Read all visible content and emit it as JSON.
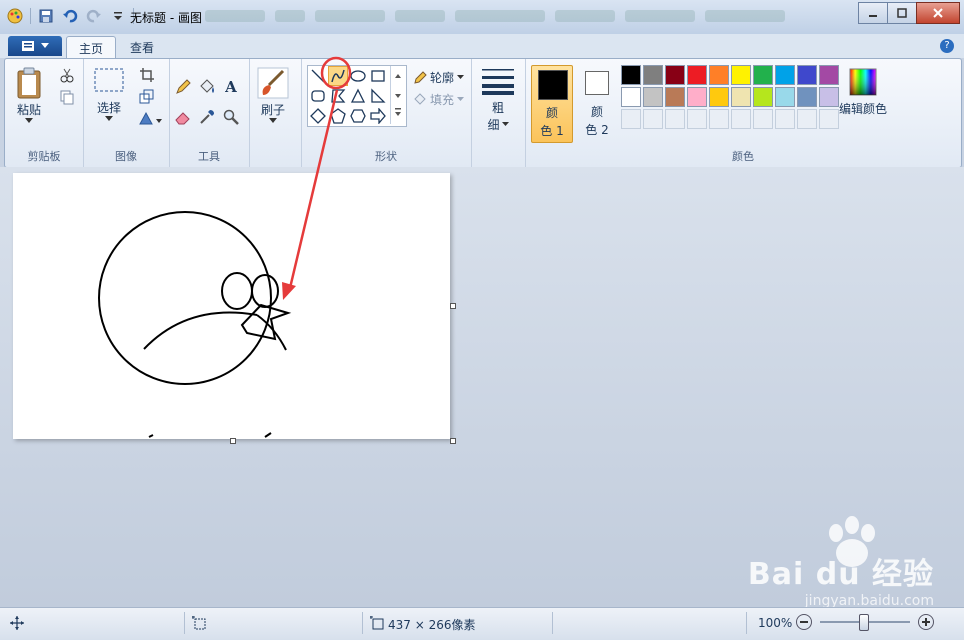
{
  "window": {
    "title": "无标题 - 画图"
  },
  "tabs": {
    "home": "主页",
    "view": "查看"
  },
  "groups": {
    "clipboard": {
      "label": "剪贴板",
      "paste": "粘贴"
    },
    "image": {
      "label": "图像",
      "select": "选择"
    },
    "tools": {
      "label": "工具"
    },
    "brushes": {
      "label": "刷子"
    },
    "shapes": {
      "label": "形状",
      "outline": "轮廓",
      "fill": "填充"
    },
    "size": {
      "label": "粗\n细",
      "l1": "粗",
      "l2": "细"
    },
    "colors": {
      "label": "颜色",
      "color1_a": "颜",
      "color1_b": "色 1",
      "color2_a": "颜",
      "color2_b": "色 2",
      "edit": "编辑颜色",
      "palette_row1": [
        "#000000",
        "#7f7f7f",
        "#880015",
        "#ed1c24",
        "#ff7f27",
        "#fff200",
        "#22b14c",
        "#00a2e8",
        "#3f48cc",
        "#a349a4"
      ],
      "palette_row2": [
        "#ffffff",
        "#c3c3c3",
        "#b97a57",
        "#ffaec9",
        "#ffc90e",
        "#efe4b0",
        "#b5e61d",
        "#99d9ea",
        "#7092be",
        "#c8bfe7"
      ]
    }
  },
  "status": {
    "dimensions": "437 × 266像素",
    "zoom": "100%"
  },
  "watermark": {
    "brand": "Bai du 经验",
    "url": "jingyan.baidu.com"
  }
}
